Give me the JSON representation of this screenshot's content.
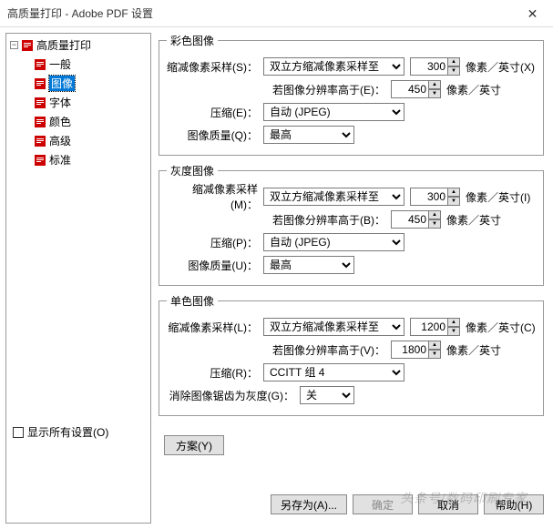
{
  "window": {
    "title": "高质量打印 - Adobe PDF 设置",
    "close": "✕"
  },
  "tree": {
    "root": "高质量打印",
    "items": [
      "一般",
      "图像",
      "字体",
      "颜色",
      "高级",
      "标准"
    ],
    "selected": 1
  },
  "sections": {
    "color": {
      "legend": "彩色图像",
      "downsample_label": "缩减像素采样(S)：",
      "downsample_value": "双立方缩减像素采样至",
      "dpi1": "300",
      "unit1": "像素／英寸(X)",
      "above_label": "若图像分辨率高于(E)：",
      "dpi2": "450",
      "unit2": "像素／英寸",
      "compress_label": "压缩(E)：",
      "compress_value": "自动 (JPEG)",
      "quality_label": "图像质量(Q)：",
      "quality_value": "最高"
    },
    "gray": {
      "legend": "灰度图像",
      "downsample_label": "缩减像素采样(M)：",
      "downsample_value": "双立方缩减像素采样至",
      "dpi1": "300",
      "unit1": "像素／英寸(I)",
      "above_label": "若图像分辨率高于(B)：",
      "dpi2": "450",
      "unit2": "像素／英寸",
      "compress_label": "压缩(P)：",
      "compress_value": "自动 (JPEG)",
      "quality_label": "图像质量(U)：",
      "quality_value": "最高"
    },
    "mono": {
      "legend": "单色图像",
      "downsample_label": "缩减像素采样(L)：",
      "downsample_value": "双立方缩减像素采样至",
      "dpi1": "1200",
      "unit1": "像素／英寸(C)",
      "above_label": "若图像分辨率高于(V)：",
      "dpi2": "1800",
      "unit2": "像素／英寸",
      "compress_label": "压缩(R)：",
      "compress_value": "CCITT 组 4",
      "antialias_label": "消除图像锯齿为灰度(G)：",
      "antialias_value": "关"
    }
  },
  "scheme_button": "方案(Y)",
  "show_all": "显示所有设置(O)",
  "buttons": {
    "save_as": "另存为(A)...",
    "ok": "确定",
    "cancel": "取消",
    "help": "帮助(H)"
  },
  "watermark": "头条号/数码印刷专家"
}
